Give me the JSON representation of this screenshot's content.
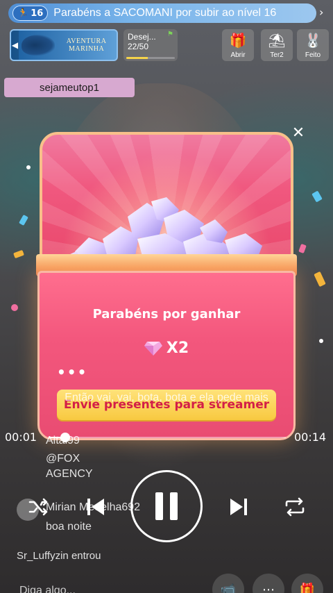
{
  "banner": {
    "level": "16",
    "text": "Parabéns a SACOMANI por subir ao nível 16"
  },
  "cards": {
    "adventure_title": "AVENTURA MARINHA",
    "desejo_label": "Desej...",
    "desejo_progress": "22/50",
    "desejo_fraction": 0.44
  },
  "quick_actions": [
    {
      "label": "Abrir"
    },
    {
      "label": "Ter2"
    },
    {
      "label": "Feito"
    }
  ],
  "user_tag": "sejameutop1",
  "reward": {
    "title": "Parabéns por ganhar",
    "multiplier": "X2",
    "more": "•••",
    "cta": "Envie presentes para streamer"
  },
  "lyric": "Então vai, vai, bota, bota e ela pede mais",
  "player": {
    "time_current": "00:01",
    "time_total": "00:14",
    "progress_fraction": 0.07
  },
  "chat": {
    "line1": "Aitai99",
    "line2a": "@FOX",
    "line2b": "AGENCY",
    "line3": "Mirian Medelha692",
    "line4": "boa noite",
    "line5_user": "Sr_Luffyzin",
    "line5_action": "entrou"
  },
  "bottom": {
    "input_placeholder": "Diga algo..."
  },
  "colors": {
    "chest_pink": "#f0587f",
    "cta_yellow": "#f8c940",
    "cta_text": "#d31e48",
    "banner_blue": "#4f8fd6"
  }
}
